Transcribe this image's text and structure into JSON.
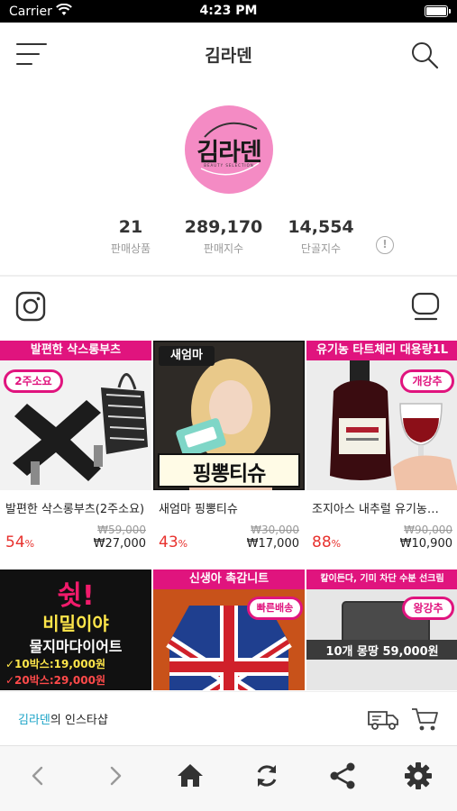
{
  "status": {
    "carrier": "Carrier",
    "time": "4:23 PM",
    "battery_level": 1.0
  },
  "header": {
    "title": "김라덴"
  },
  "profile": {
    "logo_text": "김라덴",
    "logo_sub": "BEAUTY SELECTION",
    "stats": [
      {
        "value": "21",
        "label": "판매상품"
      },
      {
        "value": "289,170",
        "label": "판매지수"
      },
      {
        "value": "14,554",
        "label": "단골지수"
      }
    ]
  },
  "products": [
    {
      "banner": "발편한 삭스롱부츠",
      "sticker": "2주소요",
      "name": "발편한 삭스롱부츠(2주소요)",
      "discount": "54",
      "original_price": "₩59,000",
      "price": "₩27,000"
    },
    {
      "banner": "새엄마",
      "sticker": "",
      "overlay": "핑뽕티슈",
      "name": "새엄마 핑뽕티슈",
      "discount": "43",
      "original_price": "₩30,000",
      "price": "₩17,000"
    },
    {
      "banner": "유기농 타트체리 대용량1L",
      "sticker": "개강추",
      "name": "조지아스 내추럴 유기농…",
      "discount": "88",
      "original_price": "₩90,000",
      "price": "₩10,900"
    },
    {
      "banner": "",
      "headline": "쉿!",
      "sub1": "비밀이야",
      "sub2": "물지마다이어트",
      "line1": "✓10박스:19,000원",
      "line2": "✓20박스:29,000원"
    },
    {
      "banner": "신생아 촉감니트",
      "sticker": "빠른배송"
    },
    {
      "banner": "칼이든다, 기미 차단 수분 선크림",
      "sticker": "왕강추",
      "overlay": "10개 몽땅 59,000원"
    }
  ],
  "percent_symbol": "%",
  "shop_bar": {
    "name_accent": "김라덴",
    "name_rest": "의 인스타샵"
  },
  "colors": {
    "brand_pink": "#e0147e",
    "sale_red": "#e8322e",
    "accent_teal": "#1aa3c7",
    "logo_bg": "#f48bc4"
  }
}
